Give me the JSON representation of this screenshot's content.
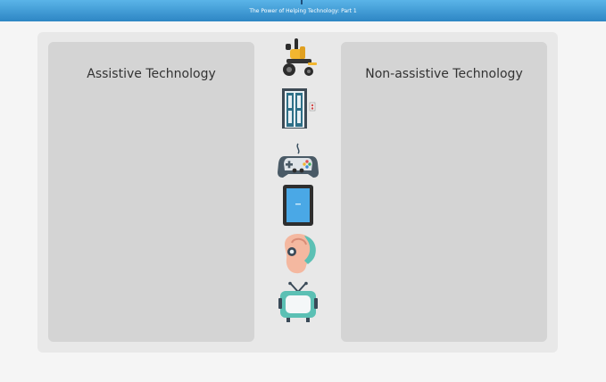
{
  "header": {
    "title": "The Power of Helping Technology: Part 1"
  },
  "zones": {
    "assistive_title": "Assistive Technology",
    "non_assistive_title": "Non-assistive Technology"
  },
  "items": [
    {
      "name": "wheelchair",
      "icon": "wheelchair-icon"
    },
    {
      "name": "elevator",
      "icon": "elevator-icon"
    },
    {
      "name": "game controller",
      "icon": "game-controller-icon"
    },
    {
      "name": "tablet",
      "icon": "tablet-icon"
    },
    {
      "name": "hearing aid",
      "icon": "hearing-aid-icon"
    },
    {
      "name": "television",
      "icon": "television-icon"
    }
  ],
  "colors": {
    "header": "#3a97d4",
    "panel": "#e8e8e8",
    "dropzone": "#d4d4d4"
  }
}
